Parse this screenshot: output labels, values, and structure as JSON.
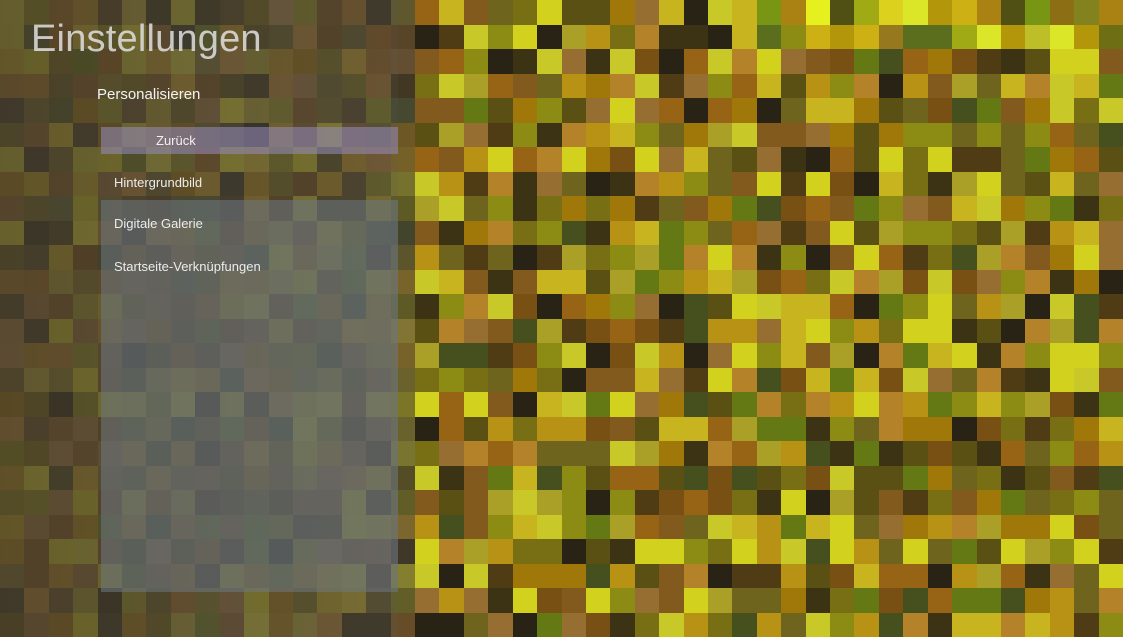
{
  "window": {
    "title": "Einstellungen"
  },
  "menu": {
    "heading": "Personalisieren",
    "back_label": "Zurück",
    "items": [
      {
        "label": "Hintergrundbild"
      },
      {
        "label": "Digitale Galerie"
      },
      {
        "label": "Startseite-Verknüpfungen"
      }
    ]
  },
  "colors": {
    "back_highlight": "#968cbe",
    "panel_tint": "#6e7882",
    "title_text": "#e1e1e1"
  }
}
